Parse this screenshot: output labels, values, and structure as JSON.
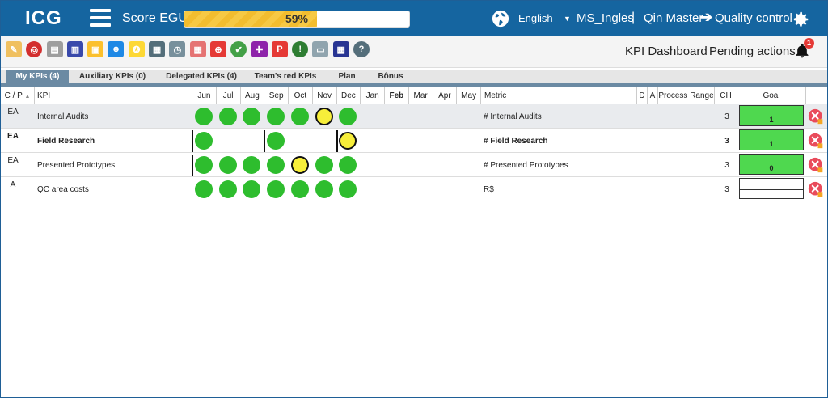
{
  "header": {
    "logo": "ICG",
    "score_label": "Score EGU:",
    "score_text": "59%",
    "score_value": 0.59,
    "language": "English",
    "user": "MS_Ingles",
    "separator": "|",
    "unit": "Qin Master",
    "module": "Quality control"
  },
  "toolbar": {
    "icons": [
      "notepad-icon",
      "target-icon",
      "clipboard-icon",
      "chart-down-icon",
      "folder-icon",
      "team-icon",
      "award-icon",
      "calendar-icon",
      "stopwatch-icon",
      "hierarchy-icon",
      "crosshair-icon",
      "check-circle-icon",
      "puzzle-icon",
      "pdf-icon",
      "alert-off-icon",
      "presentation-icon",
      "grid-icon",
      "help-icon"
    ],
    "kpi_dashboard": "KPI Dashboard",
    "pending_actions": "Pending actions",
    "notification_count": "1"
  },
  "tabs": [
    "My KPIs (4)",
    "Auxiliary KPIs (0)",
    "Delegated KPIs (4)",
    "Team's red KPIs",
    "Plan",
    "Bônus"
  ],
  "columns": {
    "cp": "C / P",
    "kpi": "KPI",
    "months": [
      "Jun",
      "Jul",
      "Aug",
      "Sep",
      "Oct",
      "Nov",
      "Dec",
      "Jan",
      "Feb",
      "Mar",
      "Apr",
      "May"
    ],
    "metric": "Metric",
    "d": "D",
    "a": "A",
    "process_range": "Process Range",
    "ch": "CH",
    "goal": "Goal"
  },
  "rows": [
    {
      "cp": "EA",
      "kpi": "Internal Audits",
      "metric": "# Internal Audits",
      "ch": "3",
      "goal": "1",
      "goal_style": "green",
      "bold": false,
      "highlight": true,
      "dots": [
        "g",
        "g",
        "g",
        "g",
        "g",
        "y",
        "g"
      ],
      "bars": []
    },
    {
      "cp": "EA",
      "kpi": "Field Research",
      "metric": "# Field Research",
      "ch": "3",
      "goal": "1",
      "goal_style": "green",
      "bold": true,
      "highlight": false,
      "dots": [
        "g",
        "",
        "",
        "g",
        "",
        "",
        "y"
      ],
      "bars": [
        0,
        3,
        6
      ]
    },
    {
      "cp": "EA",
      "kpi": "Presented Prototypes",
      "metric": "# Presented Prototypes",
      "ch": "3",
      "goal": "0",
      "goal_style": "green",
      "bold": false,
      "highlight": false,
      "dots": [
        "g",
        "g",
        "g",
        "g",
        "y",
        "g",
        "g"
      ],
      "bars": [
        0
      ]
    },
    {
      "cp": "A",
      "kpi": "QC area costs",
      "metric": "R$",
      "ch": "3",
      "goal": "",
      "goal_style": "empty",
      "bold": false,
      "highlight": false,
      "dots": [
        "g",
        "g",
        "g",
        "g",
        "g",
        "g",
        "g"
      ],
      "bars": []
    }
  ]
}
